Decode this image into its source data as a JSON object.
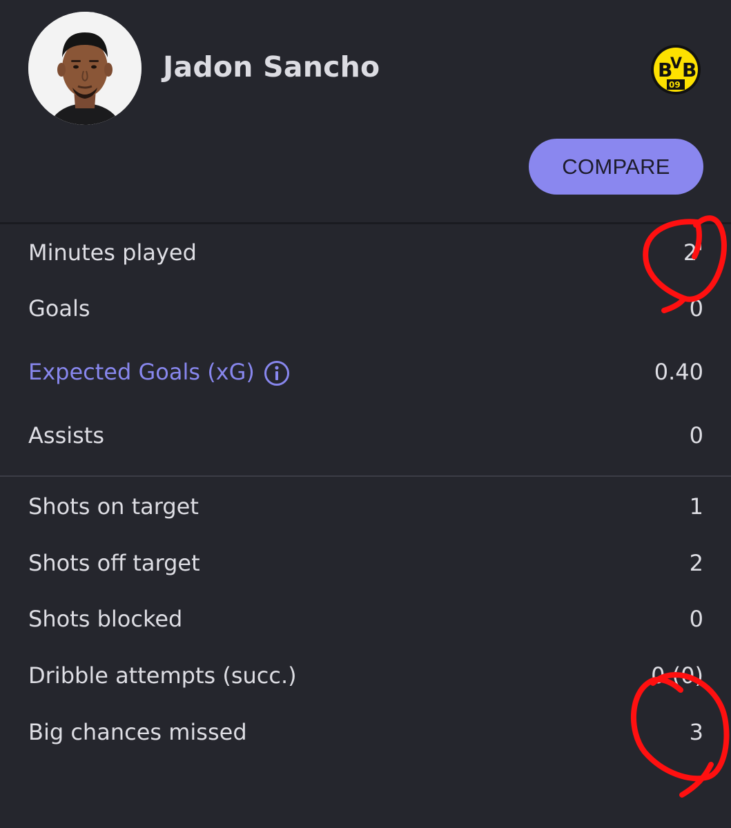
{
  "player": {
    "name": "Jadon Sancho",
    "avatar_icon": "player-photo",
    "club_badge": {
      "icon": "bvb-crest-icon",
      "lettering": "BVB 09",
      "colors": {
        "yellow": "#fde100",
        "black": "#111111"
      }
    }
  },
  "actions": {
    "compare_label": "COMPARE"
  },
  "stats_primary": [
    {
      "label": "Minutes played",
      "value": "2'"
    },
    {
      "label": "Goals",
      "value": "0"
    },
    {
      "label": "Expected Goals (xG)",
      "value": "0.40",
      "info_icon": "info-icon"
    },
    {
      "label": "Assists",
      "value": "0"
    }
  ],
  "stats_secondary": [
    {
      "label": "Shots on target",
      "value": "1"
    },
    {
      "label": "Shots off target",
      "value": "2"
    },
    {
      "label": "Shots blocked",
      "value": "0"
    },
    {
      "label": "Dribble attempts (succ.)",
      "value": "0 (0)"
    },
    {
      "label": "Big chances missed",
      "value": "3"
    }
  ],
  "colors": {
    "background": "#25262d",
    "accent": "#8a87ef",
    "link_text": "#8887ee",
    "annotation_red": "#ff1010"
  }
}
